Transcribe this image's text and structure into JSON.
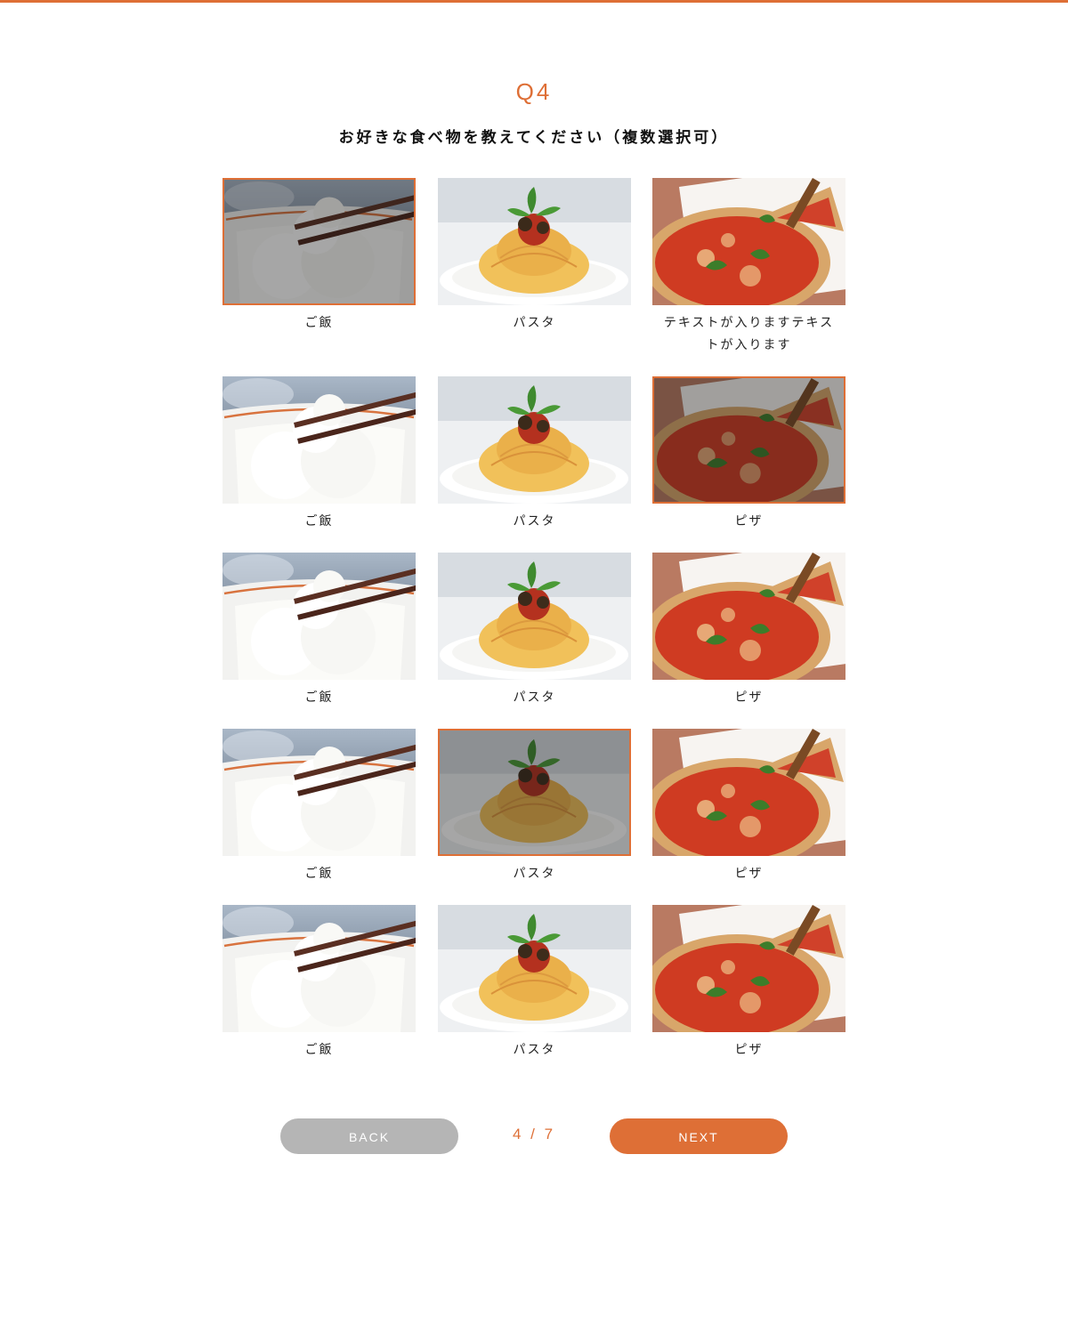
{
  "brand": {
    "accent": "#de6f36",
    "button_back_bg": "#b5b5b5"
  },
  "question": {
    "number": "Q4",
    "text": "お好きな食べ物を教えてください（複数選択可）"
  },
  "options": [
    {
      "label": "ご飯",
      "image": "rice-bowl",
      "selected": true
    },
    {
      "label": "パスタ",
      "image": "pasta-plate",
      "selected": false
    },
    {
      "label": "テキストが入りますテキストが入ります",
      "image": "pizza",
      "selected": false
    },
    {
      "label": "ご飯",
      "image": "rice-bowl",
      "selected": false
    },
    {
      "label": "パスタ",
      "image": "pasta-plate",
      "selected": false
    },
    {
      "label": "ピザ",
      "image": "pizza",
      "selected": true
    },
    {
      "label": "ご飯",
      "image": "rice-bowl",
      "selected": false
    },
    {
      "label": "パスタ",
      "image": "pasta-plate",
      "selected": false
    },
    {
      "label": "ピザ",
      "image": "pizza",
      "selected": false
    },
    {
      "label": "ご飯",
      "image": "rice-bowl",
      "selected": false
    },
    {
      "label": "パスタ",
      "image": "pasta-plate",
      "selected": true
    },
    {
      "label": "ピザ",
      "image": "pizza",
      "selected": false
    },
    {
      "label": "ご飯",
      "image": "rice-bowl",
      "selected": false
    },
    {
      "label": "パスタ",
      "image": "pasta-plate",
      "selected": false
    },
    {
      "label": "ピザ",
      "image": "pizza",
      "selected": false
    }
  ],
  "nav": {
    "back_label": "BACK",
    "next_label": "NEXT",
    "progress": "4 / 7"
  }
}
